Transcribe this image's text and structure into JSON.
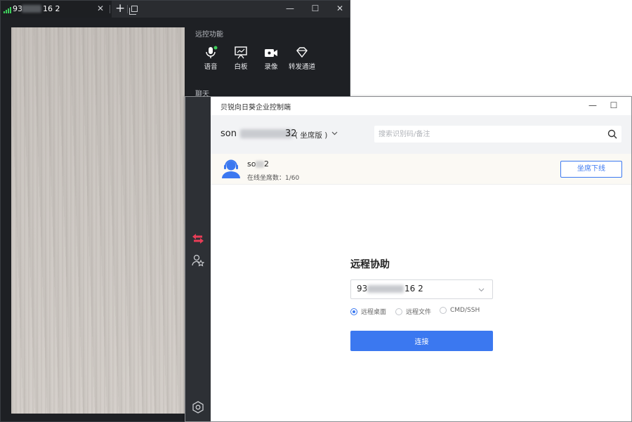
{
  "viewer": {
    "tab_title_head": "93",
    "tab_title_tail": "16 2",
    "tab_close_glyph": "✕",
    "add_tab_glyph": "+",
    "window_buttons": {
      "minimize": "—",
      "maximize": "☐",
      "close": "✕"
    },
    "section_remote_functions": "远控功能",
    "functions": [
      {
        "label": "语音",
        "icon": "microphone-icon"
      },
      {
        "label": "白板",
        "icon": "whiteboard-icon"
      },
      {
        "label": "录像",
        "icon": "video-record-icon"
      },
      {
        "label": "转发通道",
        "icon": "forward-channel-icon"
      }
    ],
    "section_chat": "聊天"
  },
  "console": {
    "window_title": "贝锐向日葵企业控制端",
    "window_buttons": {
      "minimize": "—",
      "maximize": "☐",
      "close": "✕"
    },
    "account": {
      "name_head": "son",
      "name_tail": "32",
      "edition": "( 坐席版 )"
    },
    "search": {
      "placeholder": "搜索识别码/备注",
      "value": ""
    },
    "seat": {
      "name_head": "so",
      "name_tail": "2",
      "online_count": "在线坐席数：1/60",
      "offline_button": "坐席下线"
    },
    "assist": {
      "title": "远程协助",
      "device_head": "93",
      "device_tail": "16 2",
      "modes": [
        {
          "label": "远程桌面",
          "selected": true
        },
        {
          "label": "远程文件",
          "selected": false
        },
        {
          "label": "CMD/SSH",
          "selected": false
        }
      ],
      "connect_button": "连接"
    }
  },
  "colors": {
    "accent": "#3b78f0",
    "signal_green": "#3ecf5b",
    "remote_icon_red": "#e83d57",
    "dark_bg": "#1e2024"
  }
}
